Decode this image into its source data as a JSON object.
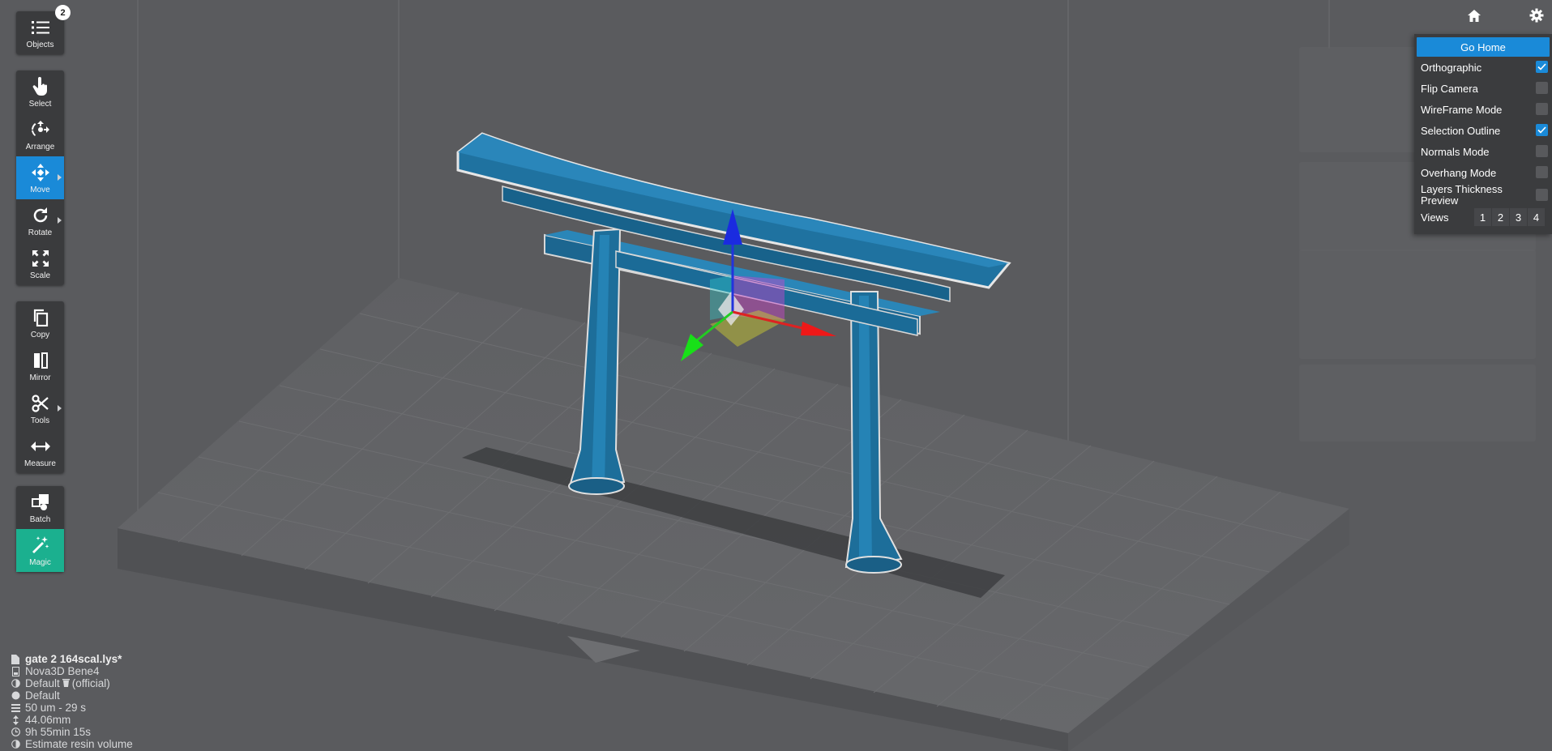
{
  "toolbar": {
    "objects": {
      "label": "Objects",
      "count": "2",
      "icon": "list-icon"
    },
    "tools": [
      {
        "key": "select",
        "label": "Select",
        "icon": "pointer-hand-icon"
      },
      {
        "key": "arrange",
        "label": "Arrange",
        "icon": "arrange-icon"
      },
      {
        "key": "move",
        "label": "Move",
        "icon": "move-arrows-icon",
        "active": true
      },
      {
        "key": "rotate",
        "label": "Rotate",
        "icon": "rotate-icon"
      },
      {
        "key": "scale",
        "label": "Scale",
        "icon": "scale-icon"
      },
      {
        "key": "copy",
        "label": "Copy",
        "icon": "copy-icon"
      },
      {
        "key": "mirror",
        "label": "Mirror",
        "icon": "mirror-icon"
      },
      {
        "key": "tools",
        "label": "Tools",
        "icon": "scissors-icon"
      },
      {
        "key": "measure",
        "label": "Measure",
        "icon": "measure-icon"
      },
      {
        "key": "batch",
        "label": "Batch",
        "icon": "batch-icon"
      },
      {
        "key": "magic",
        "label": "Magic",
        "icon": "magic-wand-icon"
      }
    ]
  },
  "top_icons": {
    "home": "home-icon",
    "settings": "gear-icon"
  },
  "settings_menu": {
    "go_home": "Go Home",
    "options": [
      {
        "label": "Orthographic",
        "checked": true
      },
      {
        "label": "Flip Camera",
        "checked": false
      },
      {
        "label": "WireFrame Mode",
        "checked": false
      },
      {
        "label": "Selection Outline",
        "checked": true
      },
      {
        "label": "Normals Mode",
        "checked": false
      },
      {
        "label": "Overhang Mode",
        "checked": false
      },
      {
        "label": "Layers Thickness Preview",
        "checked": false
      }
    ],
    "views_label": "Views",
    "views": [
      "1",
      "2",
      "3",
      "4"
    ]
  },
  "info": {
    "file": "gate 2 164scal.lys*",
    "printer": "Nova3D Bene4",
    "profile": "Default",
    "profile_icon": "trash-icon",
    "profile_tag": "(official)",
    "material": "Default",
    "layer": "50 um - 29 s",
    "height": "44.06mm",
    "time": "9h 55min 15s",
    "resin": "Estimate resin volume"
  },
  "colors": {
    "background": "#5a5b5e",
    "model": "#1f6f9c",
    "accent": "#1a8ad8",
    "magic": "#1bb08f"
  }
}
